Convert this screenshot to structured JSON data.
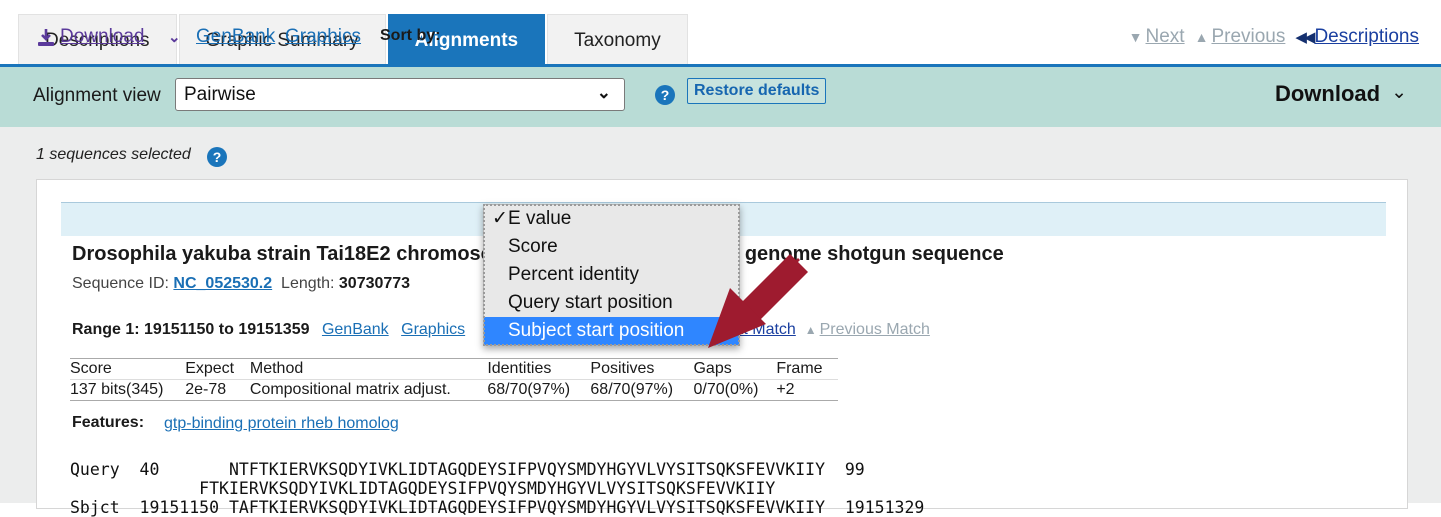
{
  "tabs": [
    {
      "label": "Descriptions",
      "active": false
    },
    {
      "label": "Graphic Summary",
      "active": false
    },
    {
      "label": "Alignments",
      "active": true
    },
    {
      "label": "Taxonomy",
      "active": false
    }
  ],
  "toolbar": {
    "alignment_view_label": "Alignment view",
    "alignment_view_value": "Pairwise",
    "help_icon": "help-circle-icon",
    "restore_defaults_label": "Restore defaults",
    "download_label": "Download",
    "download_caret": "⌄"
  },
  "selection": {
    "text": "1 sequences selected",
    "help_icon": "help-circle-icon"
  },
  "card_header": {
    "download_label": "Download",
    "download_icon": "download-icon",
    "download_caret": "⌄",
    "genbank_label": "GenBank",
    "graphics_label": "Graphics",
    "sort_by_label": "Sort by:",
    "next_label": "Next",
    "previous_label": "Previous",
    "descriptions_label": "Descriptions",
    "next_triangle": "▼",
    "previous_triangle": "▲",
    "descriptions_arrow": "◀◀"
  },
  "sort_menu": {
    "items": [
      {
        "label": "E value",
        "checked": true,
        "selected": false
      },
      {
        "label": "Score",
        "checked": false,
        "selected": false
      },
      {
        "label": "Percent identity",
        "checked": false,
        "selected": false
      },
      {
        "label": "Query start position",
        "checked": false,
        "selected": false
      },
      {
        "label": "Subject start position",
        "checked": false,
        "selected": true
      }
    ],
    "check_glyph": "✓"
  },
  "hit": {
    "title": "Drosophila yakuba strain Tai18E2 chromosome 3R Tai18E2_2.1, whole genome shotgun sequence",
    "sequence_id_label": "Sequence ID:",
    "sequence_id": "NC_052530.2",
    "length_label": "Length:",
    "length": "30730773",
    "range_text": "Range 1: 19151150 to 19151359",
    "range_genbank": "GenBank",
    "range_graphics": "Graphics",
    "next_match": "Next Match",
    "previous_match": "Previous Match",
    "next_match_triangle": "▼",
    "previous_match_triangle": "▲"
  },
  "stats": {
    "headers": [
      "Score",
      "Expect",
      "Method",
      "Identities",
      "Positives",
      "Gaps",
      "Frame"
    ],
    "values": [
      "137 bits(345)",
      "2e-78",
      "Compositional matrix adjust.",
      "68/70(97%)",
      "68/70(97%)",
      "0/70(0%)",
      "+2"
    ]
  },
  "features": {
    "label": "Features:",
    "value": "gtp-binding protein rheb homolog"
  },
  "alignment": {
    "query_label": "Query",
    "query_start": "40",
    "query_seq": "NTFTKIERVKSQDYIVKLIDTAGQDEYSIFPVQYSMDYHGYVLVYSITSQKSFEVVKIIY",
    "query_end": "99",
    "midline": "  FTKIERVKSQDYIVKLIDTAGQDEYSIFPVQYSMDYHGYVLVYSITSQKSFEVVKIIY",
    "sbjct_label": "Sbjct",
    "sbjct_start": "19151150",
    "sbjct_seq": "TAFTKIERVKSQDYIVKLIDTAGQDEYSIFPVQYSMDYHGYVLVYSITSQKSFEVVKIIY",
    "sbjct_end": "19151329"
  },
  "colors": {
    "accent_blue": "#1a75bb",
    "toolbar_teal": "#b9dcd6",
    "menu_highlight": "#2f86ff",
    "arrow_red": "#9e1b2f",
    "link_blue": "#1a6fb5",
    "visited_purple": "#5b3a9b"
  }
}
